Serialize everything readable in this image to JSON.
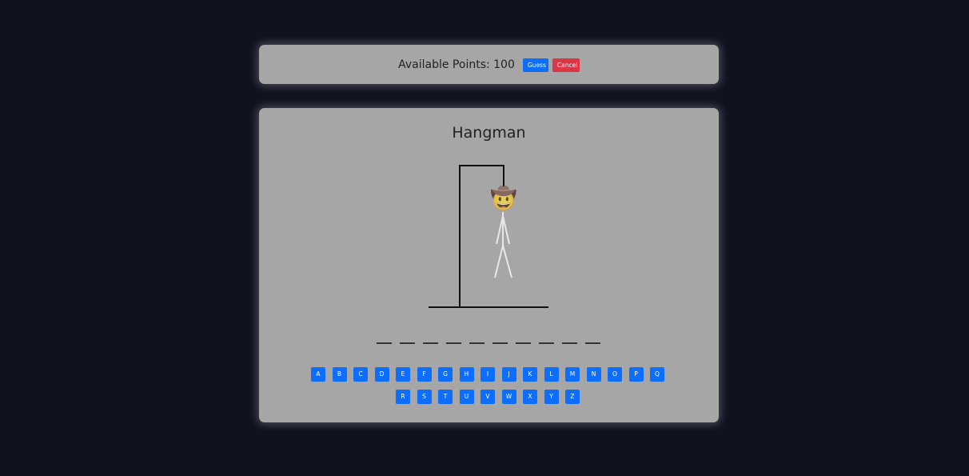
{
  "top_bar": {
    "points_label": "Available Points: 100",
    "guess_label": "Guess",
    "cancel_label": "Cancel"
  },
  "game": {
    "title": "Hangman",
    "hangman_face": "🤠",
    "word_slots": [
      "",
      "",
      "",
      "",
      "",
      "",
      "",
      "",
      "",
      ""
    ],
    "keyboard_row1": [
      "A",
      "B",
      "C",
      "D",
      "E",
      "F",
      "G",
      "H",
      "I",
      "J",
      "K",
      "L",
      "M",
      "N",
      "O",
      "P",
      "Q"
    ],
    "keyboard_row2": [
      "R",
      "S",
      "T",
      "U",
      "V",
      "W",
      "X",
      "Y",
      "Z"
    ]
  },
  "colors": {
    "page_background": "#10121f",
    "panel_background": "#a6a6a6",
    "primary_button": "#0d6efd",
    "danger_button": "#dc3545"
  }
}
